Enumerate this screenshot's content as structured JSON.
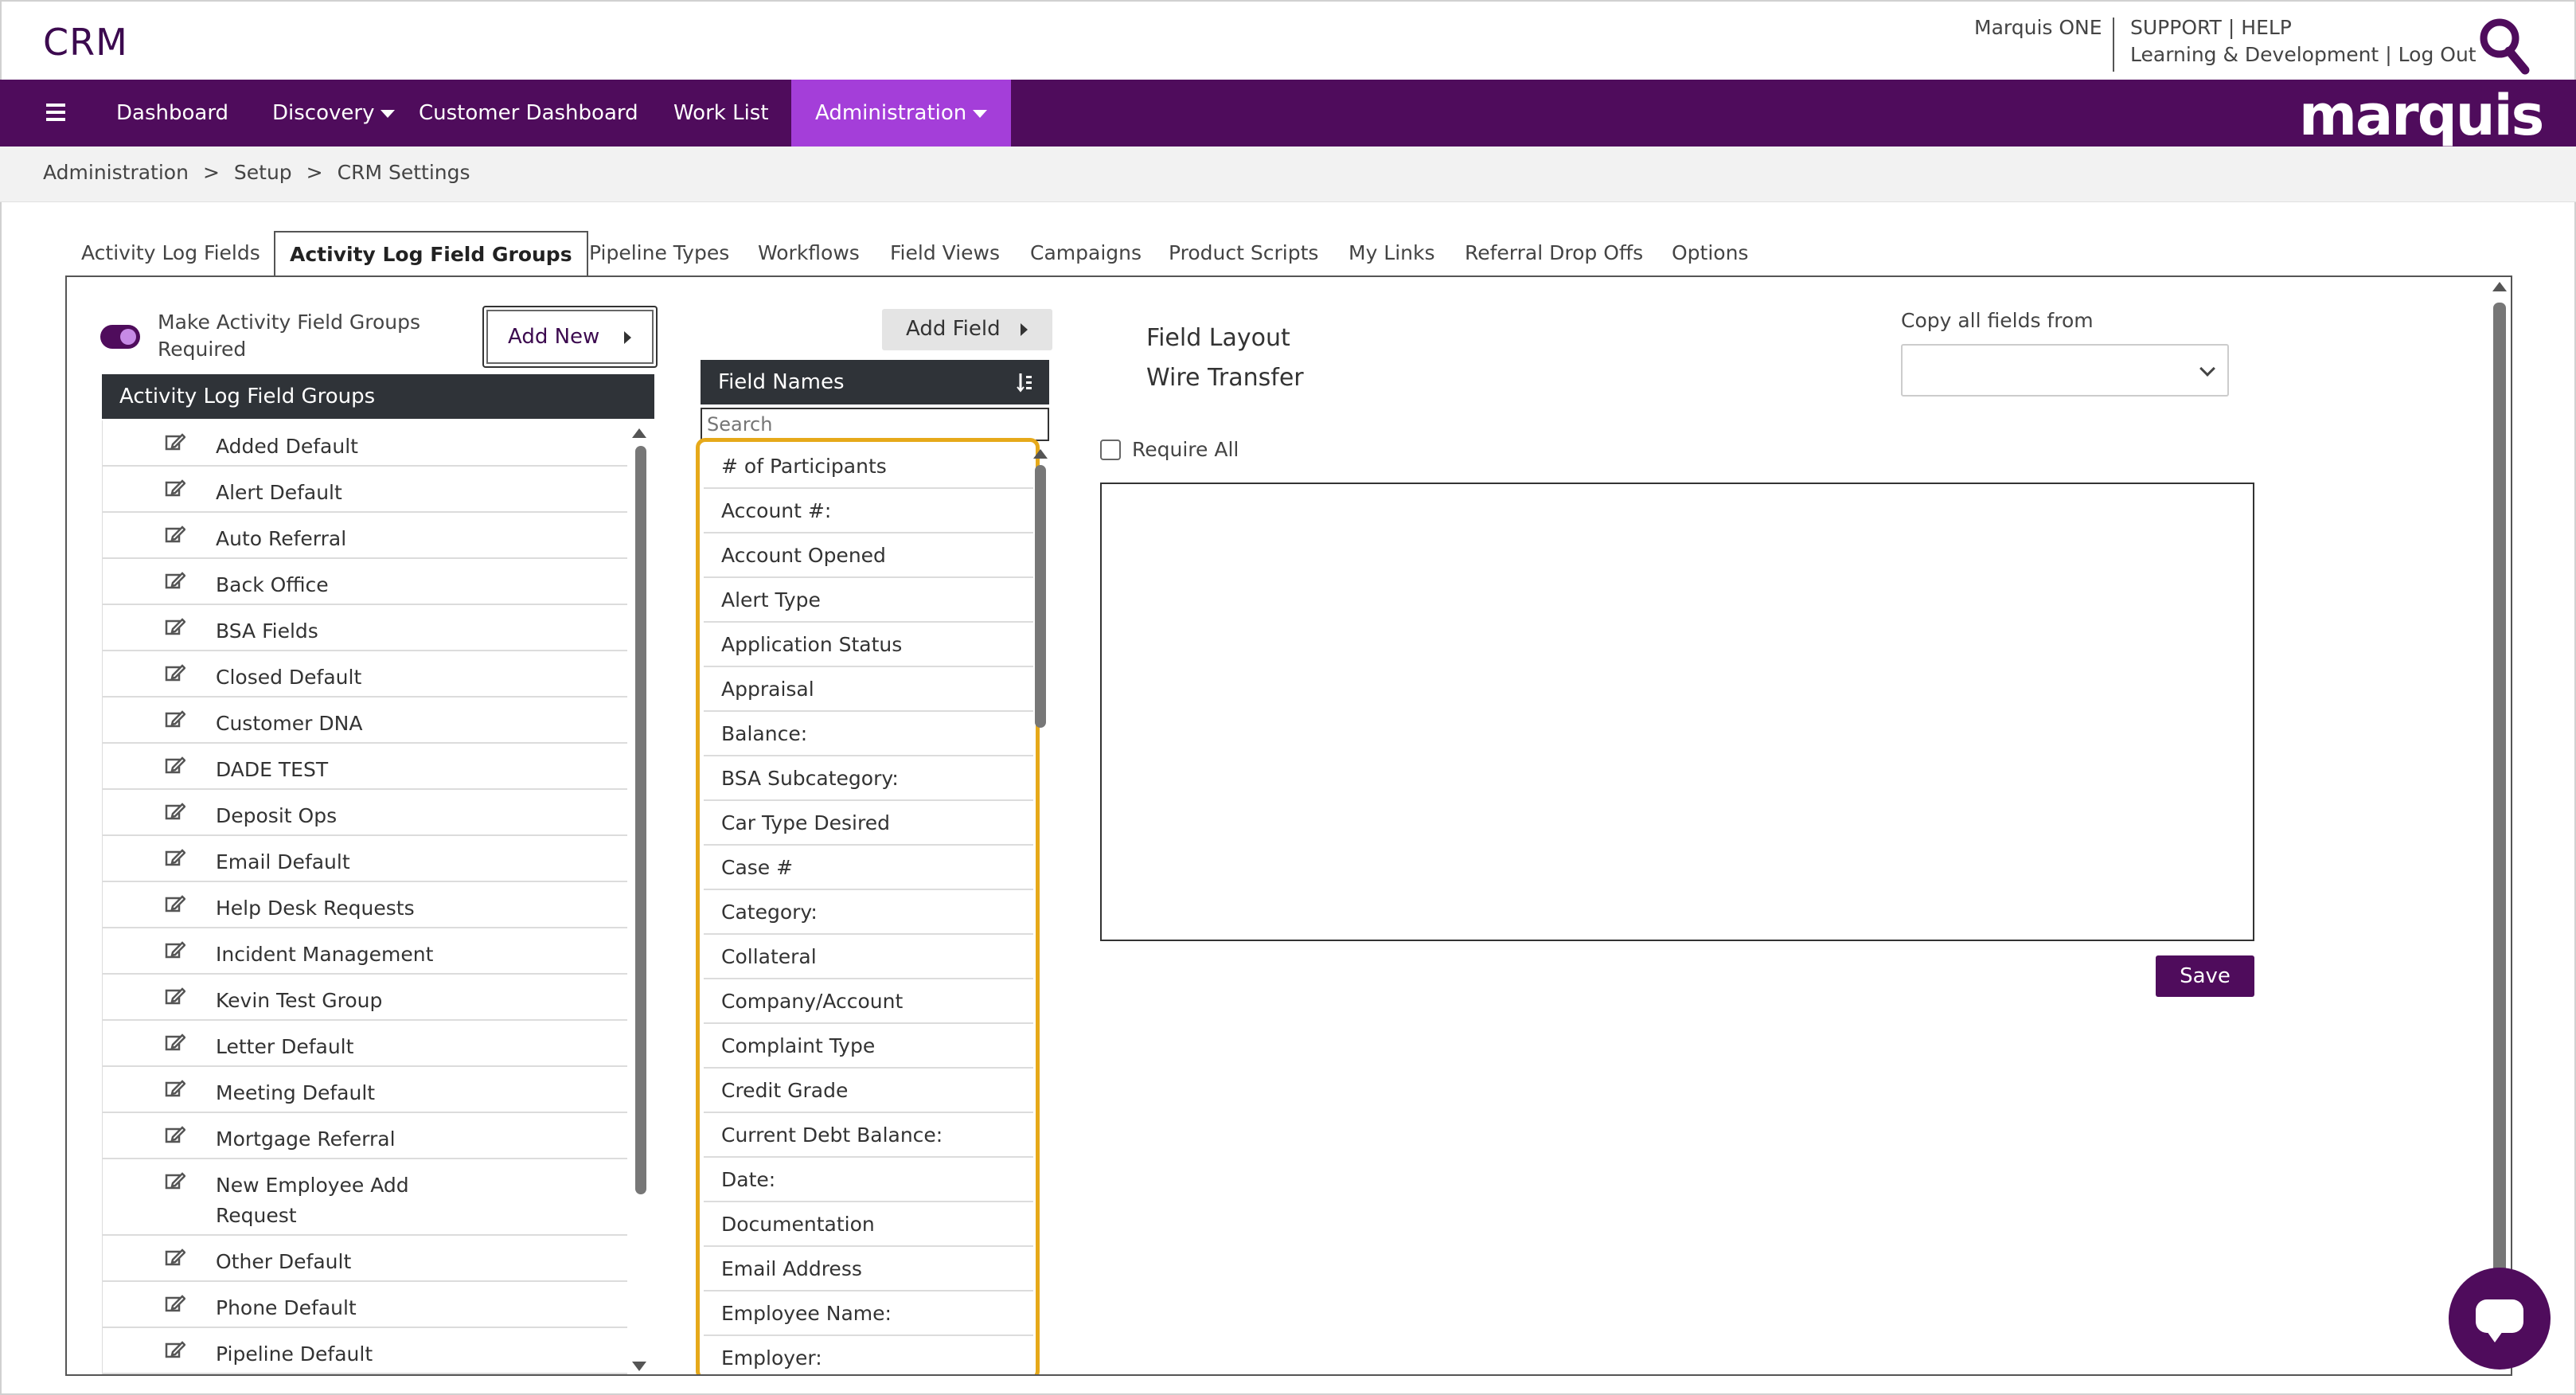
{
  "header": {
    "app_title": "CRM",
    "marquis_one": "Marquis ONE",
    "support": "SUPPORT",
    "help": "HELP",
    "learning": "Learning & Development",
    "logout": "Log Out",
    "separator": "|"
  },
  "nav": {
    "items": [
      "Dashboard",
      "Discovery",
      "Customer Dashboard",
      "Work List",
      "Administration"
    ],
    "brand": "marquis"
  },
  "breadcrumb": [
    "Administration",
    "Setup",
    "CRM Settings"
  ],
  "breadcrumb_sep": ">",
  "tabs": [
    "Activity Log Fields",
    "Activity Log Field Groups",
    "Pipeline Types",
    "Workflows",
    "Field Views",
    "Campaigns",
    "Product Scripts",
    "My Links",
    "Referral Drop Offs",
    "Options"
  ],
  "toggle": {
    "label": "Make Activity Field Groups Required",
    "on": true
  },
  "add_new_label": "Add New",
  "groups": {
    "header": "Activity Log Field Groups",
    "items": [
      "Added Default",
      "Alert Default",
      "Auto Referral",
      "Back Office",
      "BSA Fields",
      "Closed Default",
      "Customer DNA",
      "DADE TEST",
      "Deposit Ops",
      "Email Default",
      "Help Desk Requests",
      "Incident Management",
      "Kevin Test Group",
      "Letter Default",
      "Meeting Default",
      "Mortgage Referral",
      "New Employee Add Request",
      "Other Default",
      "Phone Default",
      "Pipeline Default"
    ]
  },
  "field_names": {
    "add_field_label": "Add Field",
    "header": "Field Names",
    "search_placeholder": "Search",
    "items": [
      "# of Participants",
      "Account #:",
      "Account Opened",
      "Alert Type",
      "Application Status",
      "Appraisal",
      "Balance:",
      "BSA Subcategory:",
      "Car Type Desired",
      "Case #",
      "Category:",
      "Collateral",
      "Company/Account",
      "Complaint Type",
      "Credit Grade",
      "Current Debt Balance:",
      "Date:",
      "Documentation",
      "Email Address",
      "Employee Name:",
      "Employer:"
    ]
  },
  "layout": {
    "title": "Field Layout",
    "group_name": "Wire Transfer",
    "copy_label": "Copy all fields from",
    "copy_value": "",
    "require_all_label": "Require All",
    "save_label": "Save"
  },
  "colors": {
    "brand_purple": "#4f0c5c",
    "active_nav": "#a43ed9",
    "highlight": "#e6a91a",
    "header_dark": "#2f3338"
  }
}
